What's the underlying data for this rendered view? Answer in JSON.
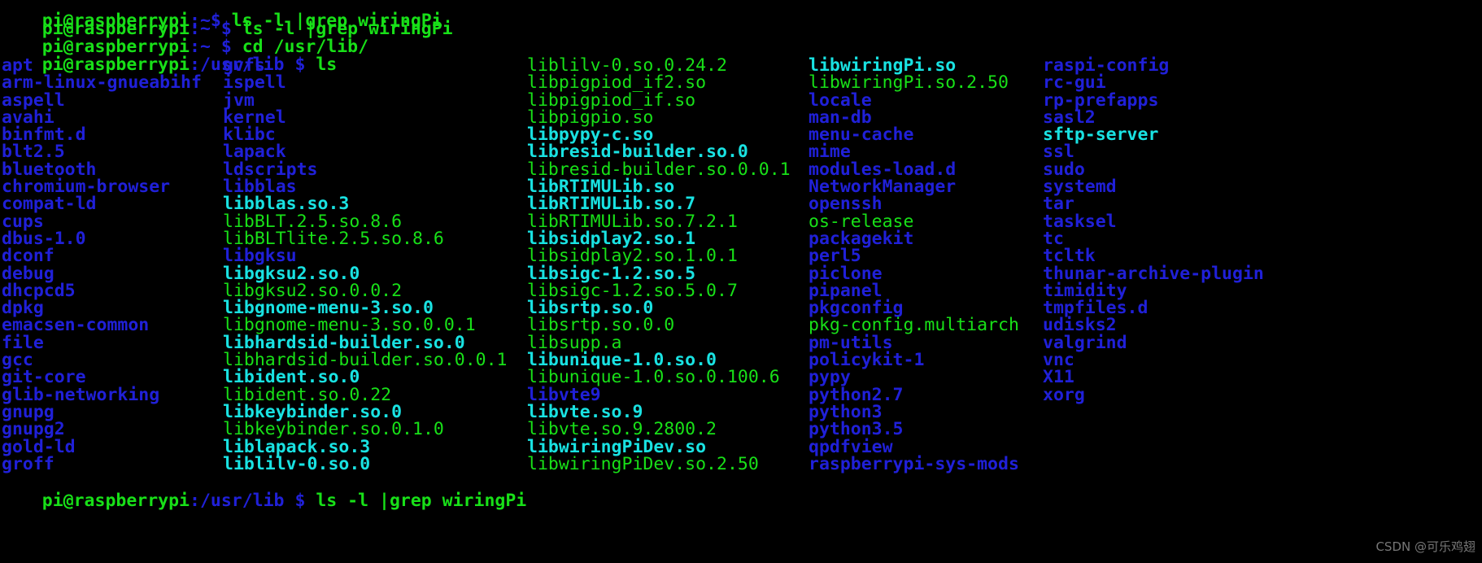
{
  "terminal": {
    "background_color": "#000000",
    "colors": {
      "prompt_user_host": "#18e018",
      "prompt_path": "#2020d8",
      "prompt_symbol": "#2020d8",
      "command_text": "#18e018",
      "directory": "#2020d8",
      "executable": "#18e018",
      "symlink": "#19e2e2",
      "archive": "#18e018"
    },
    "scrollback_clipped_line": {
      "user_host": "pi@raspberrypi",
      "path": ":~",
      "symbol": "$",
      "command": " ls -l |grep wiringPi"
    },
    "lines": [
      {
        "name": "prompt-line-1",
        "user_host": "pi@raspberrypi",
        "path": ":~",
        "symbol": " $ ",
        "command": "ls -l |grep wiringPi"
      },
      {
        "name": "prompt-line-2",
        "user_host": "pi@raspberrypi",
        "path": ":~",
        "symbol": " $ ",
        "command": "cd /usr/lib/"
      },
      {
        "name": "prompt-line-3",
        "user_host": "pi@raspberrypi",
        "path": ":/usr/lib",
        "symbol": " $ ",
        "command": "ls"
      }
    ],
    "bottom_prompt": {
      "name": "prompt-line-bottom",
      "user_host": "pi@raspberrypi",
      "path": ":/usr/lib",
      "symbol": " $ ",
      "command": "ls -l |grep wiringPi"
    },
    "watermark": "CSDN @可乐鸡翅"
  },
  "ls_listing": {
    "command": "ls",
    "working_directory": "/usr/lib",
    "column_count": 5,
    "columns": [
      {
        "index": 0,
        "entries": [
          {
            "name": "apt",
            "type": "directory"
          },
          {
            "name": "arm-linux-gnueabihf",
            "type": "directory"
          },
          {
            "name": "aspell",
            "type": "directory"
          },
          {
            "name": "avahi",
            "type": "directory"
          },
          {
            "name": "binfmt.d",
            "type": "directory"
          },
          {
            "name": "blt2.5",
            "type": "directory"
          },
          {
            "name": "bluetooth",
            "type": "directory"
          },
          {
            "name": "chromium-browser",
            "type": "directory"
          },
          {
            "name": "compat-ld",
            "type": "directory"
          },
          {
            "name": "cups",
            "type": "directory"
          },
          {
            "name": "dbus-1.0",
            "type": "directory"
          },
          {
            "name": "dconf",
            "type": "directory"
          },
          {
            "name": "debug",
            "type": "directory"
          },
          {
            "name": "dhcpcd5",
            "type": "directory"
          },
          {
            "name": "dpkg",
            "type": "directory"
          },
          {
            "name": "emacsen-common",
            "type": "directory"
          },
          {
            "name": "file",
            "type": "directory"
          },
          {
            "name": "gcc",
            "type": "directory"
          },
          {
            "name": "git-core",
            "type": "directory"
          },
          {
            "name": "glib-networking",
            "type": "directory"
          },
          {
            "name": "gnupg",
            "type": "directory"
          },
          {
            "name": "gnupg2",
            "type": "directory"
          },
          {
            "name": "gold-ld",
            "type": "directory"
          },
          {
            "name": "groff",
            "type": "directory"
          }
        ]
      },
      {
        "index": 1,
        "entries": [
          {
            "name": "gvfs",
            "type": "directory"
          },
          {
            "name": "ispell",
            "type": "directory"
          },
          {
            "name": "jvm",
            "type": "directory"
          },
          {
            "name": "kernel",
            "type": "directory"
          },
          {
            "name": "klibc",
            "type": "directory"
          },
          {
            "name": "lapack",
            "type": "directory"
          },
          {
            "name": "ldscripts",
            "type": "directory"
          },
          {
            "name": "libblas",
            "type": "directory"
          },
          {
            "name": "libblas.so.3",
            "type": "symlink"
          },
          {
            "name": "libBLT.2.5.so.8.6",
            "type": "executable"
          },
          {
            "name": "libBLTlite.2.5.so.8.6",
            "type": "executable"
          },
          {
            "name": "libgksu",
            "type": "directory"
          },
          {
            "name": "libgksu2.so.0",
            "type": "symlink"
          },
          {
            "name": "libgksu2.so.0.0.2",
            "type": "executable"
          },
          {
            "name": "libgnome-menu-3.so.0",
            "type": "symlink"
          },
          {
            "name": "libgnome-menu-3.so.0.0.1",
            "type": "executable"
          },
          {
            "name": "libhardsid-builder.so.0",
            "type": "symlink"
          },
          {
            "name": "libhardsid-builder.so.0.0.1",
            "type": "executable"
          },
          {
            "name": "libident.so.0",
            "type": "symlink"
          },
          {
            "name": "libident.so.0.22",
            "type": "executable"
          },
          {
            "name": "libkeybinder.so.0",
            "type": "symlink"
          },
          {
            "name": "libkeybinder.so.0.1.0",
            "type": "executable"
          },
          {
            "name": "liblapack.so.3",
            "type": "symlink"
          },
          {
            "name": "liblilv-0.so.0",
            "type": "symlink"
          }
        ]
      },
      {
        "index": 2,
        "entries": [
          {
            "name": "liblilv-0.so.0.24.2",
            "type": "executable"
          },
          {
            "name": "libpigpiod_if2.so",
            "type": "executable"
          },
          {
            "name": "libpigpiod_if.so",
            "type": "executable"
          },
          {
            "name": "libpigpio.so",
            "type": "executable"
          },
          {
            "name": "libpypy-c.so",
            "type": "symlink"
          },
          {
            "name": "libresid-builder.so.0",
            "type": "symlink"
          },
          {
            "name": "libresid-builder.so.0.0.1",
            "type": "executable"
          },
          {
            "name": "libRTIMULib.so",
            "type": "symlink"
          },
          {
            "name": "libRTIMULib.so.7",
            "type": "symlink"
          },
          {
            "name": "libRTIMULib.so.7.2.1",
            "type": "executable"
          },
          {
            "name": "libsidplay2.so.1",
            "type": "symlink"
          },
          {
            "name": "libsidplay2.so.1.0.1",
            "type": "executable"
          },
          {
            "name": "libsigc-1.2.so.5",
            "type": "symlink"
          },
          {
            "name": "libsigc-1.2.so.5.0.7",
            "type": "executable"
          },
          {
            "name": "libsrtp.so.0",
            "type": "symlink"
          },
          {
            "name": "libsrtp.so.0.0",
            "type": "executable"
          },
          {
            "name": "libsupp.a",
            "type": "executable"
          },
          {
            "name": "libunique-1.0.so.0",
            "type": "symlink"
          },
          {
            "name": "libunique-1.0.so.0.100.6",
            "type": "executable"
          },
          {
            "name": "libvte9",
            "type": "directory"
          },
          {
            "name": "libvte.so.9",
            "type": "symlink"
          },
          {
            "name": "libvte.so.9.2800.2",
            "type": "executable"
          },
          {
            "name": "libwiringPiDev.so",
            "type": "symlink"
          },
          {
            "name": "libwiringPiDev.so.2.50",
            "type": "executable"
          }
        ]
      },
      {
        "index": 3,
        "entries": [
          {
            "name": "libwiringPi.so",
            "type": "symlink"
          },
          {
            "name": "libwiringPi.so.2.50",
            "type": "executable"
          },
          {
            "name": "locale",
            "type": "directory"
          },
          {
            "name": "man-db",
            "type": "directory"
          },
          {
            "name": "menu-cache",
            "type": "directory"
          },
          {
            "name": "mime",
            "type": "directory"
          },
          {
            "name": "modules-load.d",
            "type": "directory"
          },
          {
            "name": "NetworkManager",
            "type": "directory"
          },
          {
            "name": "openssh",
            "type": "directory"
          },
          {
            "name": "os-release",
            "type": "executable"
          },
          {
            "name": "packagekit",
            "type": "directory"
          },
          {
            "name": "perl5",
            "type": "directory"
          },
          {
            "name": "piclone",
            "type": "directory"
          },
          {
            "name": "pipanel",
            "type": "directory"
          },
          {
            "name": "pkgconfig",
            "type": "directory"
          },
          {
            "name": "pkg-config.multiarch",
            "type": "executable"
          },
          {
            "name": "pm-utils",
            "type": "directory"
          },
          {
            "name": "policykit-1",
            "type": "directory"
          },
          {
            "name": "pypy",
            "type": "directory"
          },
          {
            "name": "python2.7",
            "type": "directory"
          },
          {
            "name": "python3",
            "type": "directory"
          },
          {
            "name": "python3.5",
            "type": "directory"
          },
          {
            "name": "qpdfview",
            "type": "directory"
          },
          {
            "name": "raspberrypi-sys-mods",
            "type": "directory"
          }
        ]
      },
      {
        "index": 4,
        "entries": [
          {
            "name": "raspi-config",
            "type": "directory"
          },
          {
            "name": "rc-gui",
            "type": "directory"
          },
          {
            "name": "rp-prefapps",
            "type": "directory"
          },
          {
            "name": "sasl2",
            "type": "directory"
          },
          {
            "name": "sftp-server",
            "type": "symlink"
          },
          {
            "name": "ssl",
            "type": "directory"
          },
          {
            "name": "sudo",
            "type": "directory"
          },
          {
            "name": "systemd",
            "type": "directory"
          },
          {
            "name": "tar",
            "type": "directory"
          },
          {
            "name": "tasksel",
            "type": "directory"
          },
          {
            "name": "tc",
            "type": "directory"
          },
          {
            "name": "tcltk",
            "type": "directory"
          },
          {
            "name": "thunar-archive-plugin",
            "type": "directory"
          },
          {
            "name": "timidity",
            "type": "directory"
          },
          {
            "name": "tmpfiles.d",
            "type": "directory"
          },
          {
            "name": "udisks2",
            "type": "directory"
          },
          {
            "name": "valgrind",
            "type": "directory"
          },
          {
            "name": "vnc",
            "type": "directory"
          },
          {
            "name": "X11",
            "type": "directory"
          },
          {
            "name": "xorg",
            "type": "directory"
          }
        ]
      }
    ]
  }
}
